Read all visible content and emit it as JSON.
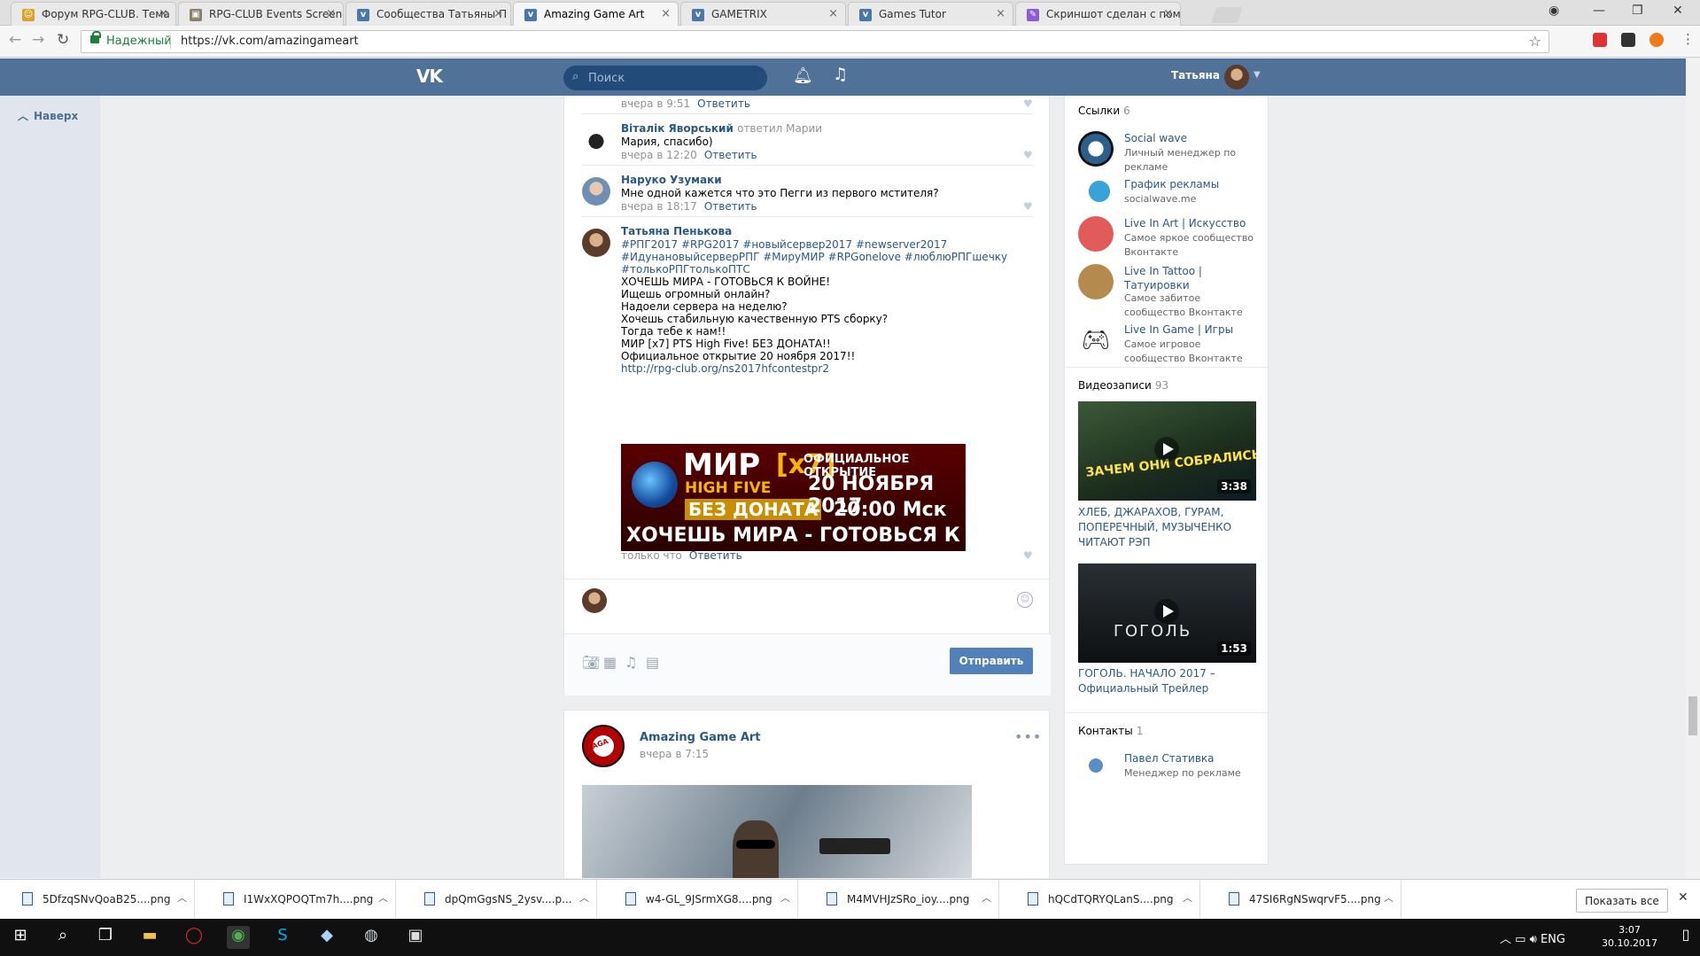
{
  "browser": {
    "tabs": [
      {
        "title": "Форум RPG-CLUB. Тема",
        "fav_color": "#d6a42b"
      },
      {
        "title": "RPG-CLUB Events Screen",
        "fav_color": "#8b7e6c"
      },
      {
        "title": "Сообщества Татьяны П",
        "fav_color": "#4a76a8"
      },
      {
        "title": "Amazing Game Art",
        "fav_color": "#4a76a8"
      },
      {
        "title": "GAMETRIX",
        "fav_color": "#4a76a8"
      },
      {
        "title": "Games Tutor",
        "fav_color": "#4a76a8"
      },
      {
        "title": "Скриншот сделан с пом",
        "fav_color": "#8a5cd6"
      }
    ],
    "secure_label": "Надежный",
    "url": "https://vk.com/amazingameart"
  },
  "vk": {
    "logo": "VK",
    "search_placeholder": "Поиск",
    "username": "Татьяна",
    "back_to_top": "Наверх"
  },
  "comments": [
    {
      "meta_time": "вчера в 9:51",
      "reply": "Ответить"
    },
    {
      "name": "Віталік Яворський",
      "reply_to": "ответил Марии",
      "text": "Мария, спасибо)",
      "meta_time": "вчера в 12:20",
      "reply": "Ответить"
    },
    {
      "name": "Наруко Узумаки",
      "text": "Мне одной кажется что это Пегги из первого мстителя?",
      "meta_time": "вчера в 18:17",
      "reply": "Ответить"
    },
    {
      "name": "Татьяна Пенькова",
      "tags": [
        "#РПГ2017 #RPG2017 #новыйсервер2017 #newserver2017",
        "#ИдунановыйсерверРПГ #МируМИР #RPGonelove #люблюРПГшечку",
        "#толькоРПГтолькоПТС"
      ],
      "lines": [
        "ХОЧЕШЬ МИРА - ГОТОВЬСЯ К ВОЙНЕ!",
        "Ищешь огромный онлайн?",
        "Надоели сервера на неделю?",
        "Хочешь стабильную качественную PTS сборку?",
        "Тогда тебе к нам!!",
        "МИР [x7] PTS High Five! БЕЗ ДОНАТА!!",
        "Официальное открытие 20 ноября 2017!!"
      ],
      "link": "http://rpg-club.org/ns2017hfcontestpr2",
      "meta_time": "только что",
      "reply": "Ответить"
    }
  ],
  "banner": {
    "mir": "МИР",
    "x7": "[x7]",
    "hf": "HIGH FIVE",
    "bd": "БЕЗ ДОНАТА",
    "oo": "ОФИЦИАЛЬНОЕ ОТКРЫТИЕ",
    "date": "20 НОЯБРЯ 2017",
    "time": "20:00 Мск",
    "slogan": "ХОЧЕШЬ МИРА - ГОТОВЬСЯ К ВОЙНЕ"
  },
  "composer": {
    "send": "Отправить"
  },
  "post2": {
    "author": "Amazing Game Art",
    "time": "вчера в 7:15"
  },
  "right": {
    "links_title": "Ссылки",
    "links_count": "6",
    "links": [
      {
        "name": "Social wave",
        "desc": "Личный менеджер по рекламе",
        "color": "#2b5f8c"
      },
      {
        "name": "График рекламы",
        "desc": "socialwave.me",
        "color": "#2a86c3"
      },
      {
        "name": "Live In Art | Искусство",
        "desc": "Самое яркое сообщество Вконтакте",
        "color": "#e25b5b"
      },
      {
        "name": "Live In Tattoo | Татуировки",
        "desc": "Самое забитое сообщество Вконтакте",
        "color": "#b58a4f"
      },
      {
        "name": "Live In Game | Игры",
        "desc": "Самое игровое сообщество Вконтакте",
        "color": "#222222"
      }
    ],
    "videos_title": "Видеозаписи",
    "videos_count": "93",
    "videos": [
      {
        "title": "ХЛЕБ, ДЖАРАХОВ, ГУРАМ, ПОПЕРЕЧНЫЙ, МУЗЫЧЕНКО ЧИТАЮТ РЭП",
        "duration": "3:38",
        "overlay": "ЗАЧЕМ ОНИ СОБРАЛИСЬ?"
      },
      {
        "title": "ГОГОЛЬ. НАЧАЛО 2017 – Официальный Трейлер",
        "duration": "1:53",
        "overlay": "ГОГОЛЬ"
      }
    ],
    "contacts_title": "Контакты",
    "contacts_count": "1",
    "contact": {
      "name": "Павел Стативка",
      "role": "Менеджер по рекламе"
    }
  },
  "downloads": {
    "files": [
      "5DfzqSNvQoaB25....png",
      "I1WxXQPOQTm7h....png",
      "dpQmGgsNS_2ysv....p...",
      "w4-GL_9JSrmXG8....png",
      "M4MVHJzSRo_ioy....png",
      "hQCdTQRYQLanS....png",
      "47SI6RgNSwqrvF5....png"
    ],
    "show_all": "Показать все"
  },
  "taskbar": {
    "lang": "ENG",
    "time": "3:07",
    "date": "30.10.2017"
  }
}
